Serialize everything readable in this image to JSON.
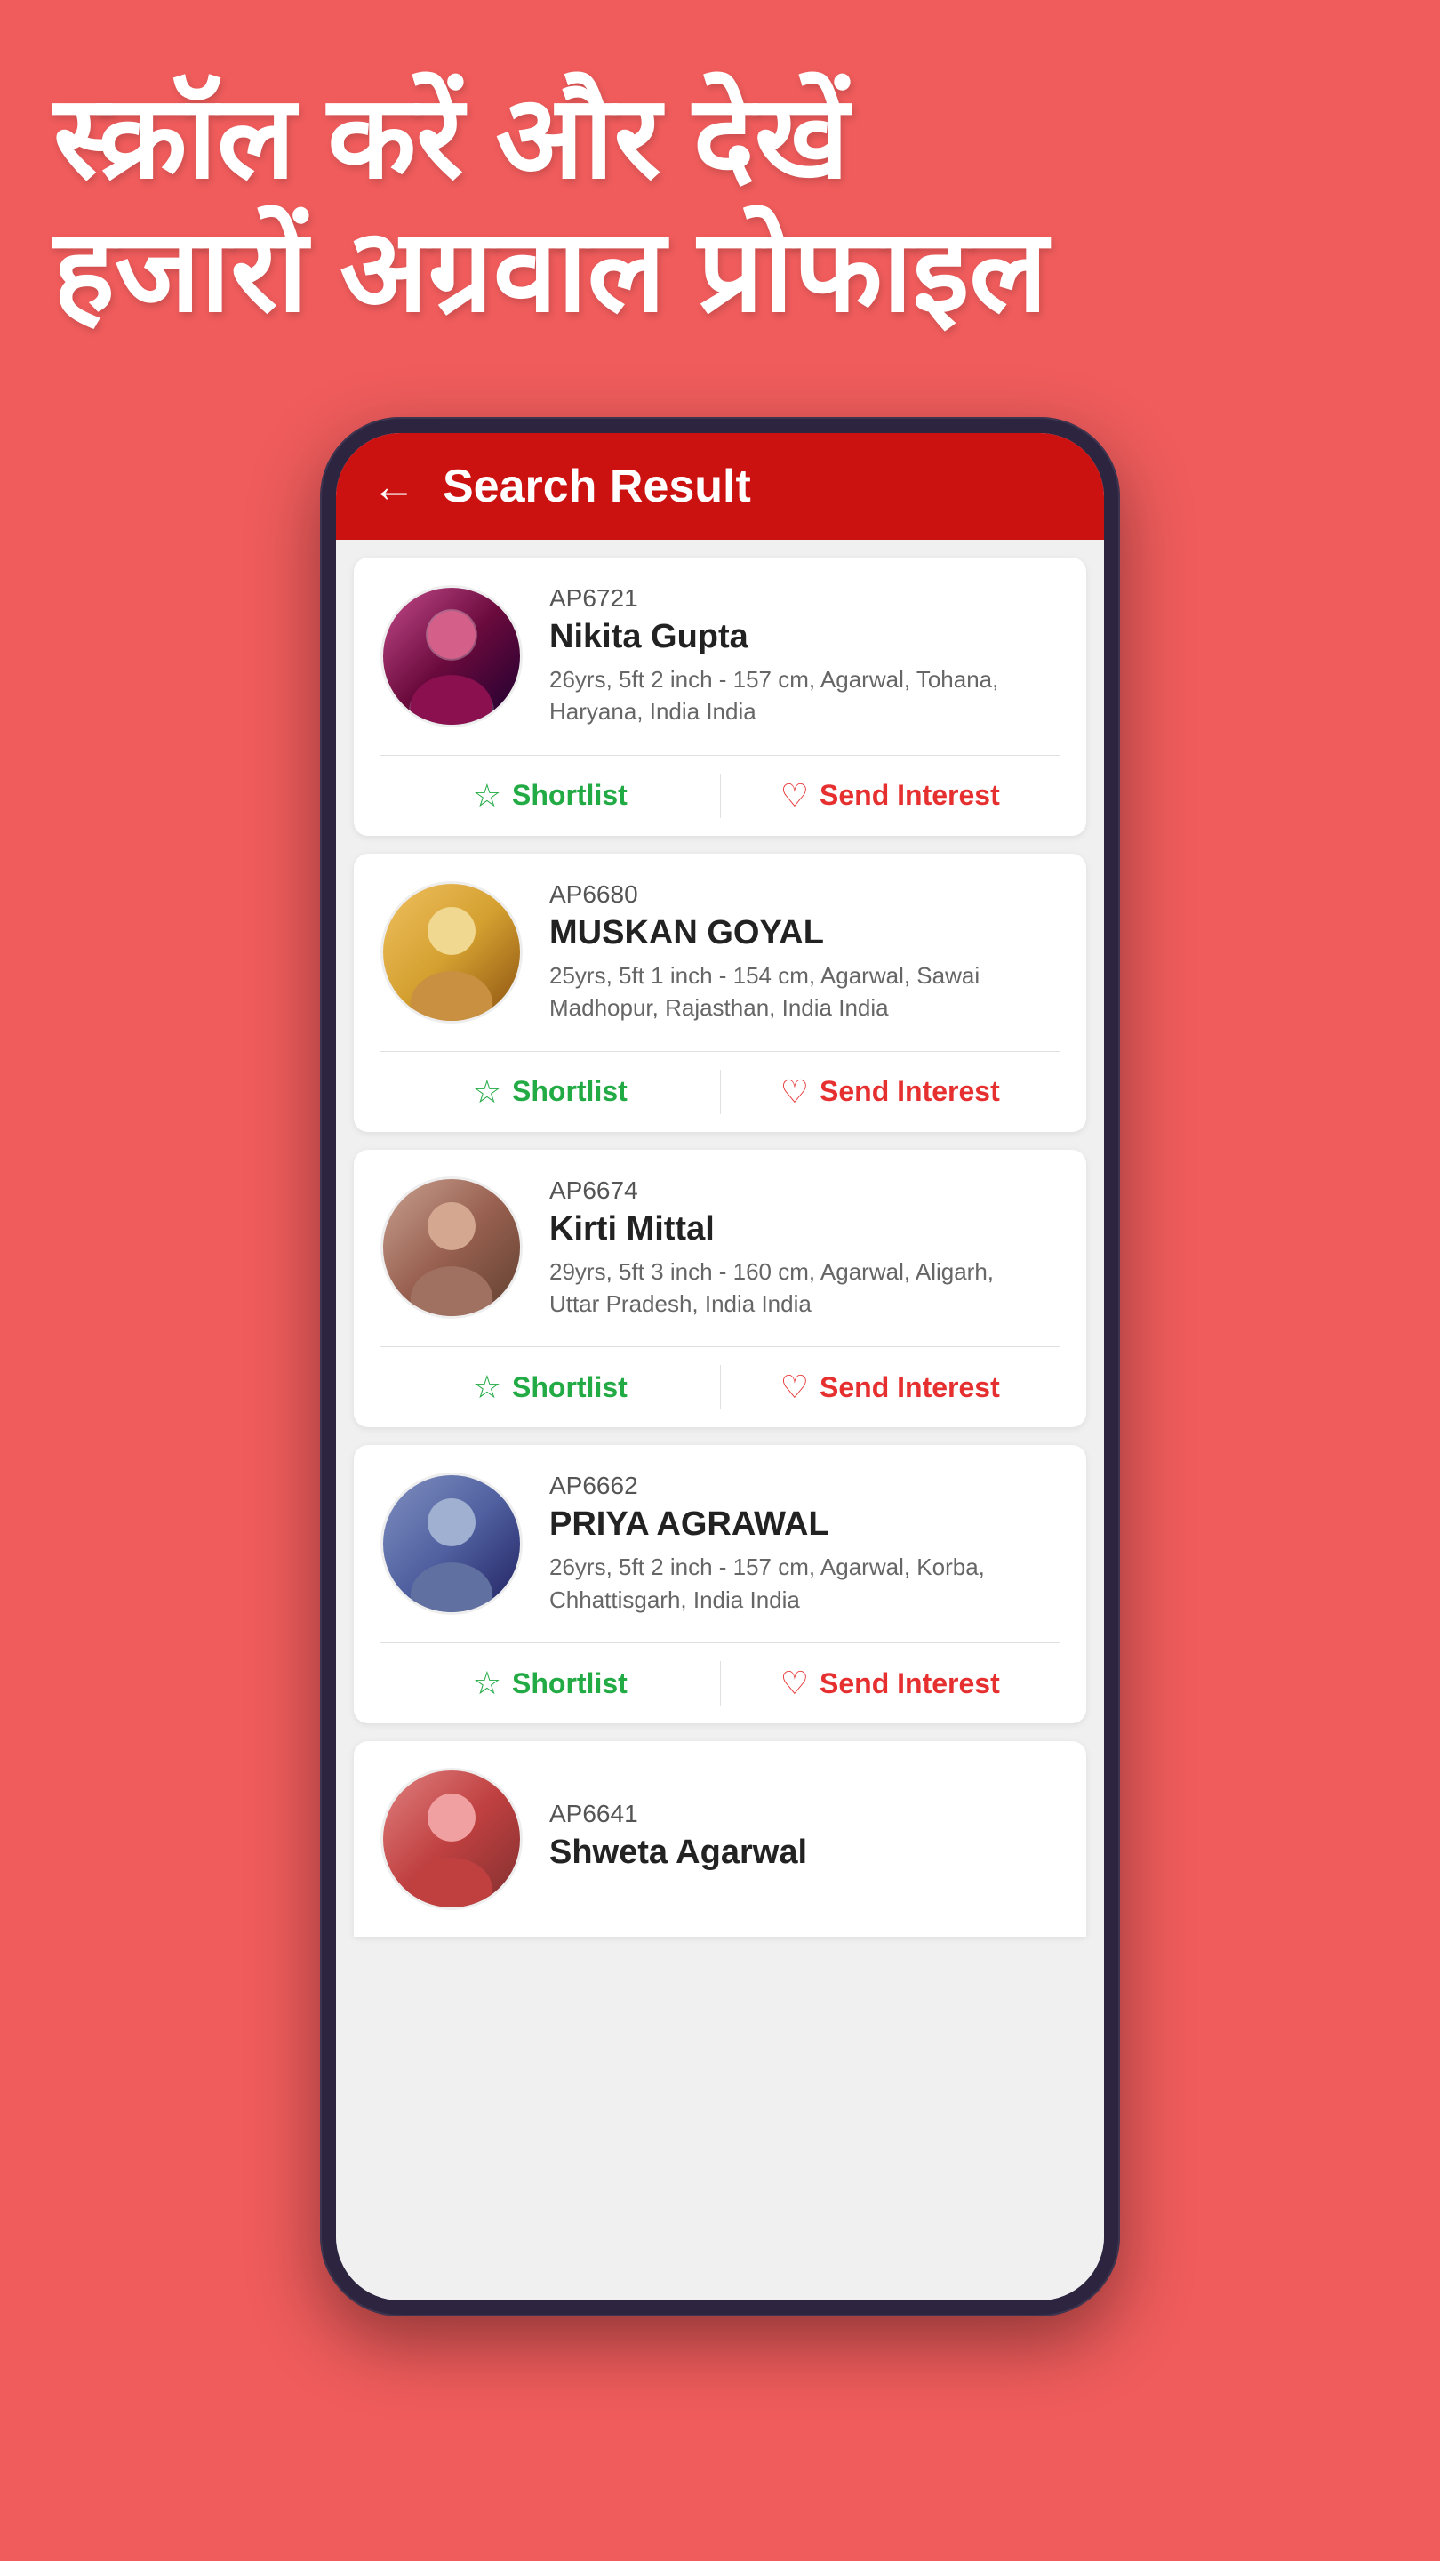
{
  "hero": {
    "line1": "स्क्रॉल करें और देखें",
    "line2": "हजारों अग्रवाल प्रोफाइल"
  },
  "app": {
    "header_title": "Search Result",
    "back_label": "←"
  },
  "actions": {
    "shortlist": "Shortlist",
    "send_interest": "Send Interest"
  },
  "profiles": [
    {
      "id": "AP6721",
      "name": "Nikita Gupta",
      "meta": "26yrs, 5ft 2 inch - 157 cm, Agarwal, Tohana,\nHaryana, India India",
      "avatar_class": "avatar-nikita"
    },
    {
      "id": "AP6680",
      "name": "MUSKAN GOYAL",
      "meta": "25yrs, 5ft 1 inch - 154 cm, Agarwal, Sawai\nMadhopur, Rajasthan, India India",
      "avatar_class": "avatar-muskan"
    },
    {
      "id": "AP6674",
      "name": "Kirti Mittal",
      "meta": "29yrs, 5ft 3 inch - 160 cm, Agarwal, Aligarh,\nUttar Pradesh, India India",
      "avatar_class": "avatar-kirti"
    },
    {
      "id": "AP6662",
      "name": "PRIYA AGRAWAL",
      "meta": "26yrs, 5ft 2 inch - 157 cm, Agarwal, Korba,\nChhattisgarh, India India",
      "avatar_class": "avatar-priya"
    },
    {
      "id": "AP6641",
      "name": "Shweta Agarwal",
      "meta": "",
      "avatar_class": "avatar-shweta",
      "partial": true
    }
  ]
}
